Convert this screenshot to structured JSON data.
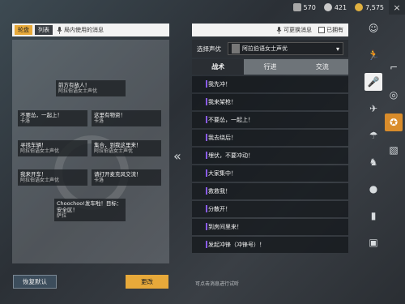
{
  "topbar": {
    "currencies": [
      {
        "icon": "bp-coin-icon",
        "value": "570",
        "color": "#b0b0b0"
      },
      {
        "icon": "silver-coin-icon",
        "value": "421",
        "color": "#c9c9c9"
      },
      {
        "icon": "uc-coin-icon",
        "value": "7,575",
        "color": "#e0b040"
      }
    ],
    "close_icon": "×"
  },
  "left": {
    "tabs": [
      "轮盘",
      "列表"
    ],
    "mic_label": "局内使用的消息",
    "wheel_messages": [
      {
        "title": "前方有敌人！",
        "sub": "阿拉伯语女士声优"
      },
      {
        "title": "不要怂，一起上！",
        "sub": "卡洛"
      },
      {
        "title": "这里有物资！",
        "sub": "卡洛"
      },
      {
        "title": "寻找车辆！",
        "sub": "阿拉伯语女士声优"
      },
      {
        "title": "集合，到我这里来！",
        "sub": "阿拉伯语女士声优"
      },
      {
        "title": "我来开车！",
        "sub": "阿拉伯语女士声优"
      },
      {
        "title": "请打开麦克风交流！",
        "sub": "卡洛"
      },
      {
        "title": "Choochoo!发车啦！目标：安全区！",
        "sub": "萨拉"
      }
    ],
    "arrows": "«"
  },
  "right": {
    "header": {
      "replaceable": "可更换消息",
      "owned": "已拥有"
    },
    "voice": {
      "label": "选择声优",
      "selected": "阿拉伯语女士声优"
    },
    "categories": [
      "战术",
      "行进",
      "交流"
    ],
    "active_category": 0,
    "messages": [
      "我先冲！",
      "我来架枪！",
      "不要怂，一起上！",
      "我去绕后！",
      "埋伏，不要冲动！",
      "大家集中！",
      "救救我！",
      "分散开！",
      "到房间里来！",
      "发起冲锋（冲锋号）！"
    ],
    "hint": "可点击消息进行试听"
  },
  "buttons": {
    "reset": "恢复默认",
    "change": "更改"
  },
  "sidebar": {
    "icons": [
      "ghost-icon",
      "run-icon",
      "gun-icon",
      "mic-icon",
      "steering-wheel-icon",
      "plane-icon",
      "emblem-icon",
      "parachute-icon",
      "box-icon",
      "bear-icon",
      "bomb-icon",
      "spray-icon",
      "photo-icon"
    ]
  }
}
